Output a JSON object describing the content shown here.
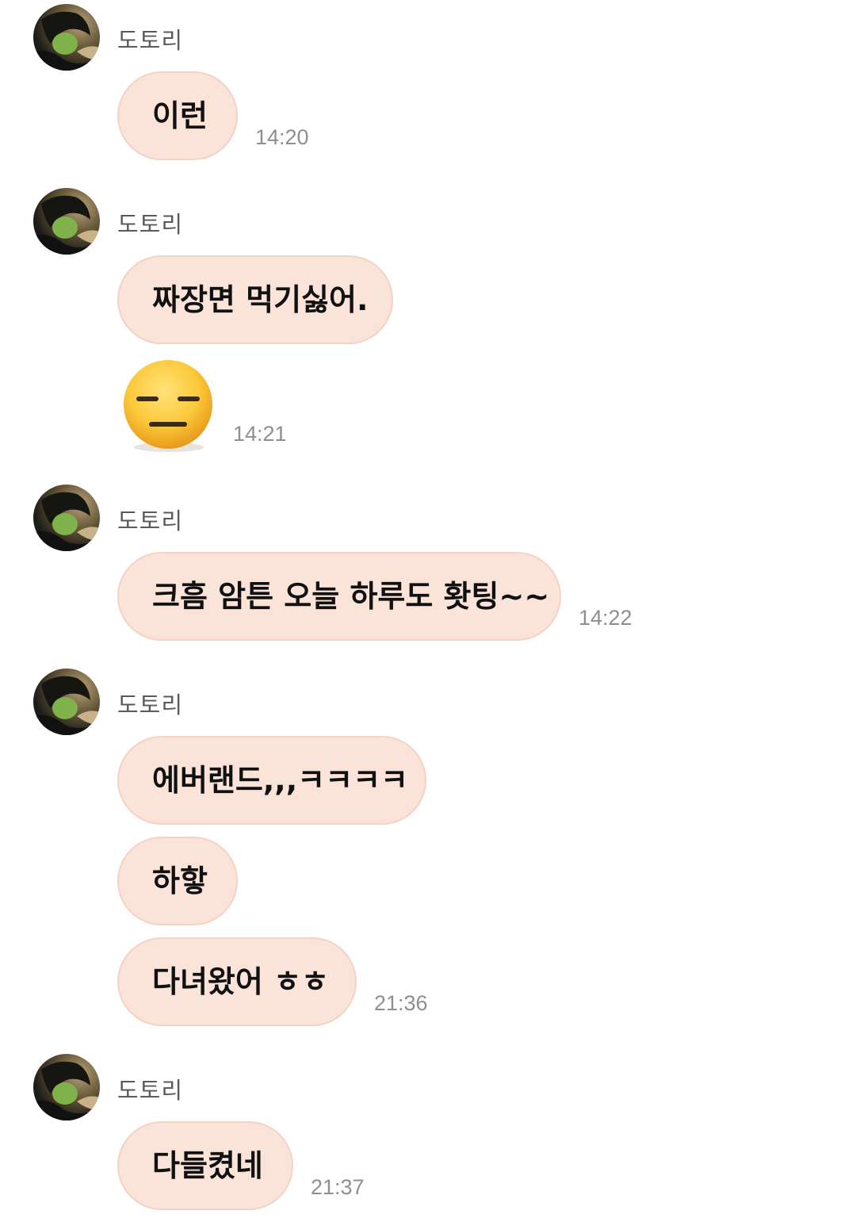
{
  "chat": {
    "groups": [
      {
        "sender": "도토리",
        "messages": [
          {
            "text": "이런"
          }
        ],
        "time": "14:20"
      },
      {
        "sender": "도토리",
        "messages": [
          {
            "text": "짜장면 먹기싫어."
          },
          {
            "sticker": "expressionless-face-emoji"
          }
        ],
        "time": "14:21"
      },
      {
        "sender": "도토리",
        "messages": [
          {
            "text": "크흠 암튼 오늘 하루도 홧팅~~"
          }
        ],
        "time": "14:22"
      },
      {
        "sender": "도토리",
        "messages": [
          {
            "text": "에버랜드,,,ㅋㅋㅋㅋ"
          },
          {
            "text": "하핳"
          },
          {
            "text": "다녀왔어 ㅎㅎ"
          }
        ],
        "time": "21:36"
      },
      {
        "sender": "도토리",
        "messages": [
          {
            "text": "다들켰네"
          }
        ],
        "time": "21:37"
      }
    ]
  },
  "colors": {
    "bubble_fill": "#fae3d8",
    "bubble_border": "#f4d3c4",
    "sender_text": "#5a5a5a",
    "time_text": "#8f8f8f",
    "message_text": "#111111",
    "background": "#ffffff"
  }
}
